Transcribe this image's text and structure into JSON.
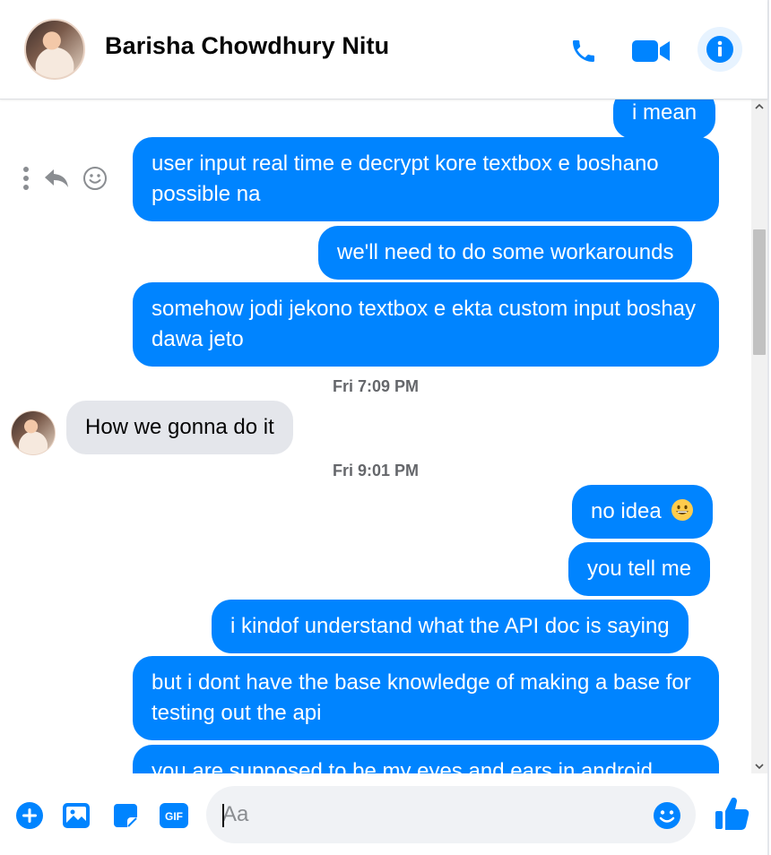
{
  "header": {
    "name": "Barisha Chowdhury Nitu"
  },
  "colors": {
    "accent": "#0084ff",
    "incoming": "#e4e6eb",
    "timestamp": "#65676b"
  },
  "messages": [
    {
      "text": "i mean",
      "direction": "out"
    },
    {
      "text": "user input real time e decrypt kore textbox e boshano possible na",
      "direction": "out"
    },
    {
      "text": "we'll need to do some workarounds",
      "direction": "out"
    },
    {
      "text": "somehow jodi jekono textbox e ekta custom input boshay dawa jeto",
      "direction": "out"
    },
    {
      "text": "How we gonna do it",
      "direction": "in"
    },
    {
      "text": "no idea",
      "direction": "out",
      "emoji": "grinning-face-icon"
    },
    {
      "text": "you tell me",
      "direction": "out"
    },
    {
      "text": "i kindof understand what the API doc is saying",
      "direction": "out"
    },
    {
      "text": "but i dont have the base knowledge of making a base for testing out the api",
      "direction": "out"
    },
    {
      "text": "you are supposed to be my eyes and ears in android",
      "direction": "out"
    }
  ],
  "timestamps": [
    "Fri 7:09 PM",
    "Fri 9:01 PM"
  ],
  "composer": {
    "placeholder": "Aa"
  }
}
